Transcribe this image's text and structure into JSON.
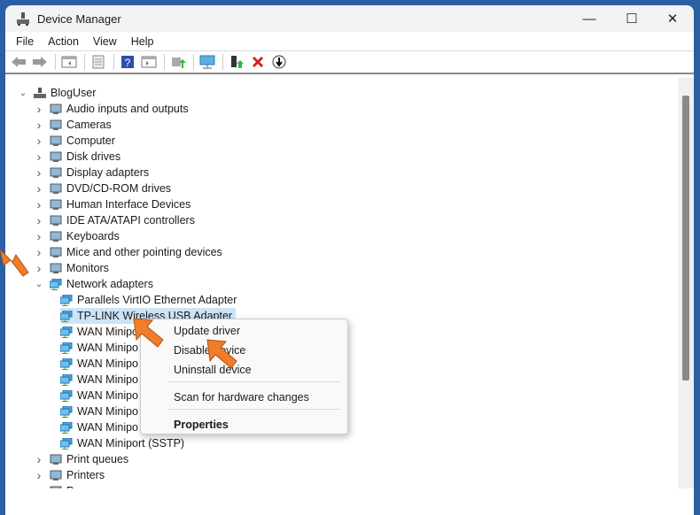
{
  "window": {
    "title": "Device Manager",
    "minimize": "—",
    "maximize": "☐",
    "close": "✕"
  },
  "menu": [
    "File",
    "Action",
    "View",
    "Help"
  ],
  "toolbar": [
    "back-icon",
    "forward-icon",
    "show-hide-console-tree-icon",
    "properties-icon",
    "help-icon",
    "action-pane-icon",
    "update-driver-icon",
    "monitor-icon",
    "enable-device-icon",
    "uninstall-icon",
    "disable-device-icon"
  ],
  "tree": {
    "root": "BlogUser",
    "categories_top": [
      "Audio inputs and outputs",
      "Cameras",
      "Computer",
      "Disk drives",
      "Display adapters",
      "DVD/CD-ROM drives",
      "Human Interface Devices",
      "IDE ATA/ATAPI controllers",
      "Keyboards",
      "Mice and other pointing devices",
      "Monitors"
    ],
    "expanded": "Network adapters",
    "children": [
      "Parallels VirtIO Ethernet Adapter",
      "TP-LINK Wireless USB Adapter",
      "WAN Minipo",
      "WAN Minipo",
      "WAN Minipo",
      "WAN Minipo",
      "WAN Minipo",
      "WAN Minipo",
      "WAN Minipo",
      "WAN Miniport (SSTP)"
    ],
    "categories_bottom": [
      "Print queues",
      "Printers",
      "Processors"
    ]
  },
  "context_menu": {
    "update": "Update driver",
    "disable": "Disable device",
    "uninstall": "Uninstall device",
    "scan": "Scan for hardware changes",
    "properties": "Properties"
  },
  "colors": {
    "accent": "#2a5fa3",
    "arrow": "#f07d2a",
    "selection": "#cce4f7"
  }
}
